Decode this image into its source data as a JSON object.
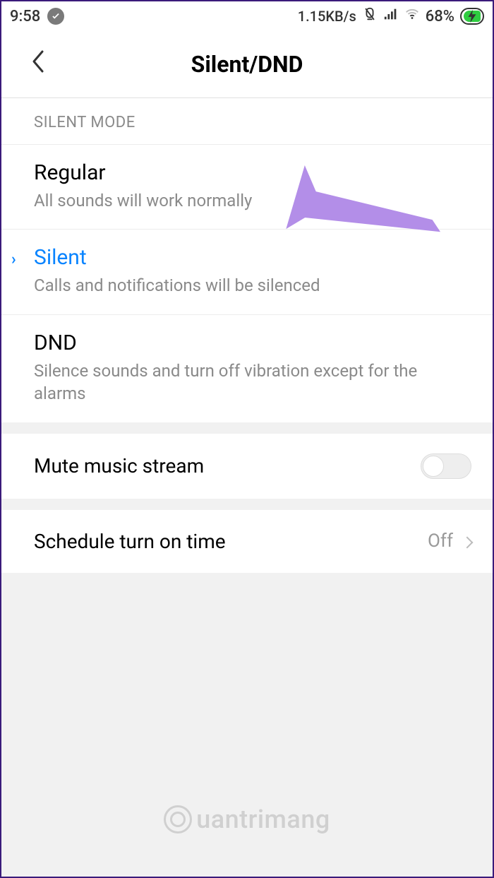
{
  "status_bar": {
    "time": "9:58",
    "data_rate": "1.15KB/s",
    "battery_pct": "68%"
  },
  "header": {
    "title": "Silent/DND"
  },
  "section_label": "SILENT MODE",
  "modes": [
    {
      "title": "Regular",
      "desc": "All sounds will work normally",
      "selected": false
    },
    {
      "title": "Silent",
      "desc": "Calls and notifications will be silenced",
      "selected": true
    },
    {
      "title": "DND",
      "desc": "Silence sounds and turn off vibration except for the alarms",
      "selected": false
    }
  ],
  "mute_row": {
    "label": "Mute music stream",
    "value": false
  },
  "schedule_row": {
    "label": "Schedule turn on time",
    "value": "Off"
  },
  "watermark": "uantrimang"
}
